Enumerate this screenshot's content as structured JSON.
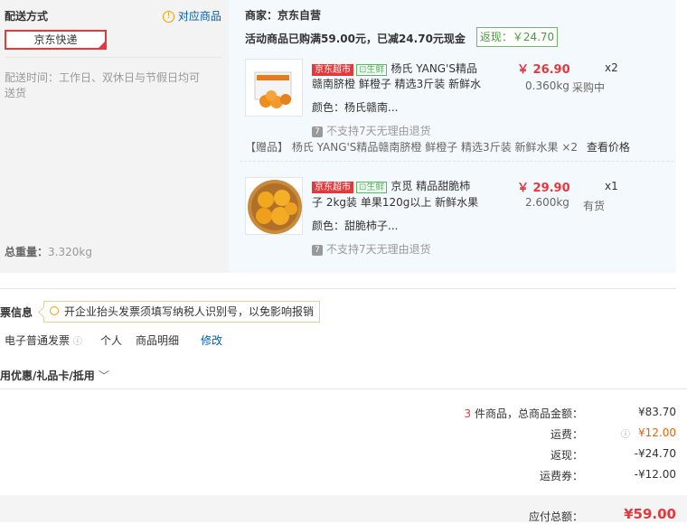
{
  "delivery": {
    "title": "配送方式",
    "corresponding_link": "对应商品",
    "option_label": "京东快递",
    "time_label": "配送时间：工作日、双休日与节假日均可送货",
    "weight_label": "总重量：",
    "weight_value": "3.320kg"
  },
  "merchant": {
    "label": "商家：京东自营",
    "promo_text": "活动商品已购满59.00元，已减24.70元现金",
    "rebate_badge": "返现：￥24.70"
  },
  "products": [
    {
      "tag_store": "京东超市",
      "tag_fresh": "生鲜",
      "title_line1": "杨氏 YANG'S精品",
      "title_line2": "赣南脐橙 鲜橙子 精选3斤装 新鲜水",
      "price": "￥ 26.90",
      "qty": "x2",
      "weight": "0.360kg",
      "stock": "采购中",
      "color": "颜色：杨氏赣南...",
      "no_return": "不支持7天无理由退货",
      "thumb_icon": "orange-box-image"
    },
    {
      "tag_store": "京东超市",
      "tag_fresh": "生鲜",
      "title_line1": "京觅 精品甜脆柿",
      "title_line2": "子 2kg装 单果120g以上 新鲜水果",
      "price": "￥ 29.90",
      "qty": "x1",
      "weight": "2.600kg",
      "stock": "有货",
      "color": "颜色：甜脆柿子...",
      "no_return": "不支持7天无理由退货",
      "thumb_icon": "persimmon-bowl-image"
    }
  ],
  "gift": {
    "text": "【赠品】 杨氏 YANG'S精品赣南脐橙 鲜橙子 精选3斤装 新鲜水果 ×2",
    "link": "查看价格"
  },
  "invoice": {
    "title": "票信息",
    "tip": "开企业抬头发票须填写纳税人识别号，以免影响报销",
    "type": "电子普通发票",
    "person": "个人",
    "detail": "商品明细",
    "modify": "修改"
  },
  "coupon": {
    "title": "用优惠/礼品卡/抵用"
  },
  "summary": {
    "count": "3",
    "count_suffix": " 件商品，总商品金额：",
    "total_amount": "¥83.70",
    "shipping_label": "运费：",
    "shipping_value": "¥12.00",
    "rebate_label": "返现：",
    "rebate_value": "-¥24.70",
    "shipping_coupon_label": "运费券：",
    "shipping_coupon_value": "-¥12.00",
    "payable_label": "应付总额：",
    "payable_value": "¥59.00"
  },
  "colors": {
    "accent_red": "#e4393c",
    "link_blue": "#005ea7",
    "rebate_green": "#4a9b3f",
    "shipping_orange": "#e4630c"
  }
}
